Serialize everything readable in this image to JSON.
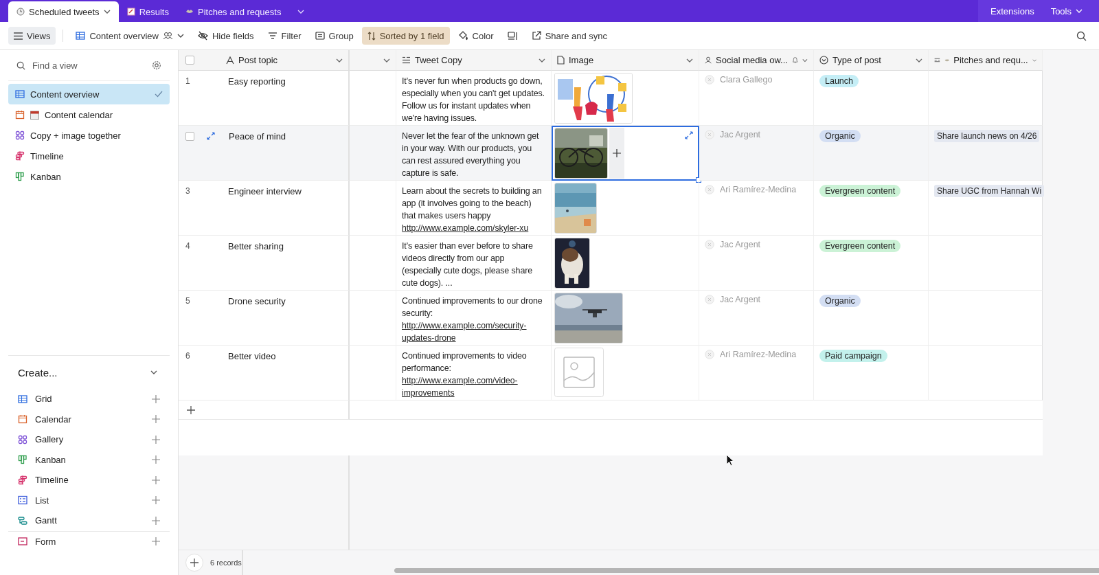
{
  "top_tabs": [
    {
      "label": "Scheduled tweets",
      "selected": true
    },
    {
      "label": "Results",
      "selected": false
    },
    {
      "label": "Pitches and requests",
      "selected": false
    }
  ],
  "top_right": [
    "Extensions",
    "Tools"
  ],
  "toolbar": {
    "views": "Views",
    "view_name": "Content overview",
    "buttons": [
      {
        "label": "Hide fields",
        "kind": "hide",
        "active": false
      },
      {
        "label": "Filter",
        "kind": "filter",
        "active": false
      },
      {
        "label": "Group",
        "kind": "group",
        "active": false
      },
      {
        "label": "Sorted by 1 field",
        "kind": "sort",
        "active": true
      },
      {
        "label": "Color",
        "kind": "color",
        "active": false
      },
      {
        "kind": "rowheight",
        "active": false
      },
      {
        "label": "Share and sync",
        "kind": "share",
        "active": false
      }
    ]
  },
  "sidebar": {
    "search": {
      "placeholder": "Find a view"
    },
    "views": [
      {
        "label": "Content overview",
        "kind": "grid",
        "selected": true
      },
      {
        "label": "Content calendar",
        "kind": "calendar",
        "selected": false
      },
      {
        "label": "Copy + image together",
        "kind": "gallery",
        "selected": false
      },
      {
        "label": "Timeline",
        "kind": "timeline",
        "selected": false
      },
      {
        "label": "Kanban",
        "kind": "kanban",
        "selected": false
      }
    ],
    "create_title": "Create...",
    "create": [
      {
        "label": "Grid",
        "kind": "grid"
      },
      {
        "label": "Calendar",
        "kind": "calendar"
      },
      {
        "label": "Gallery",
        "kind": "gallery"
      },
      {
        "label": "Kanban",
        "kind": "kanban"
      },
      {
        "label": "Timeline",
        "kind": "timeline"
      },
      {
        "label": "List",
        "kind": "list"
      },
      {
        "label": "Gantt",
        "kind": "gantt"
      }
    ],
    "create_extra": [
      {
        "label": "Form",
        "kind": "form"
      }
    ]
  },
  "table": {
    "select_all": {
      "checked": false
    },
    "columns": [
      {
        "label": "Post topic",
        "kind": "text"
      },
      {
        "kind": "blank"
      },
      {
        "label": "Tweet Copy",
        "kind": "longtext"
      },
      {
        "label": "Image",
        "kind": "attachment"
      },
      {
        "label": "Social media ow...",
        "kind": "user"
      },
      {
        "label": "Type of post",
        "kind": "select"
      },
      {
        "label": "Pitches and requ...",
        "kind": "link"
      }
    ],
    "rows": [
      {
        "number": "1",
        "hovered": false,
        "topic": "Easy reporting",
        "copy": "It's never fun when products go down, especially when you can't get updates. Follow us for instant updates when we're having issues.",
        "image": {
          "kind": "picture",
          "selected": false
        },
        "owner": "Clara Gallego",
        "type": {
          "label": "Launch",
          "color": "#c5eef6"
        }
      },
      {
        "hovered": true,
        "checked": false,
        "topic": "Peace of mind",
        "copy": "Never let the fear of the unknown get in your way. With our products, you can rest assured everything you capture is safe.",
        "image": {
          "kind": "picture",
          "selected": true
        },
        "owner": "Jac Argent",
        "type": {
          "label": "Organic",
          "color": "#d3def3"
        },
        "pitch": "Share launch news on 4/26"
      },
      {
        "number": "3",
        "hovered": false,
        "topic": "Engineer interview",
        "copy": "Learn about the secrets to building an app (it involves going to the beach) that makes users happy",
        "link": "http://www.example.com/skyler-xu",
        "image": {
          "kind": "picture",
          "selected": false
        },
        "owner": "Ari Ramírez-Medina",
        "type": {
          "label": "Evergreen content",
          "color": "#cbf2d6"
        },
        "pitch": "Share UGC from Hannah Wi"
      },
      {
        "number": "4",
        "hovered": false,
        "topic": "Better sharing",
        "copy": "It's easier than ever before to share videos directly from our app (especially cute dogs, please share cute dogs). ...",
        "image": {
          "kind": "picture",
          "selected": false
        },
        "owner": "Jac Argent",
        "type": {
          "label": "Evergreen content",
          "color": "#cbf2d6"
        }
      },
      {
        "number": "5",
        "hovered": false,
        "topic": "Drone security",
        "copy": "Continued improvements to our drone security:",
        "link": "http://www.example.com/security-updates-drone",
        "image": {
          "kind": "picture",
          "selected": false
        },
        "owner": "Jac Argent",
        "type": {
          "label": "Organic",
          "color": "#d3def3"
        }
      },
      {
        "number": "6",
        "hovered": false,
        "topic": "Better video",
        "copy": "Continued improvements to video performance:",
        "link": "http://www.example.com/video-improvements",
        "image": {
          "kind": "placeholder",
          "selected": false
        },
        "owner": "Ari Ramírez-Medina",
        "type": {
          "label": "Paid campaign",
          "color": "#c3f1ec"
        }
      }
    ]
  },
  "footer": {
    "count": "6 records"
  }
}
